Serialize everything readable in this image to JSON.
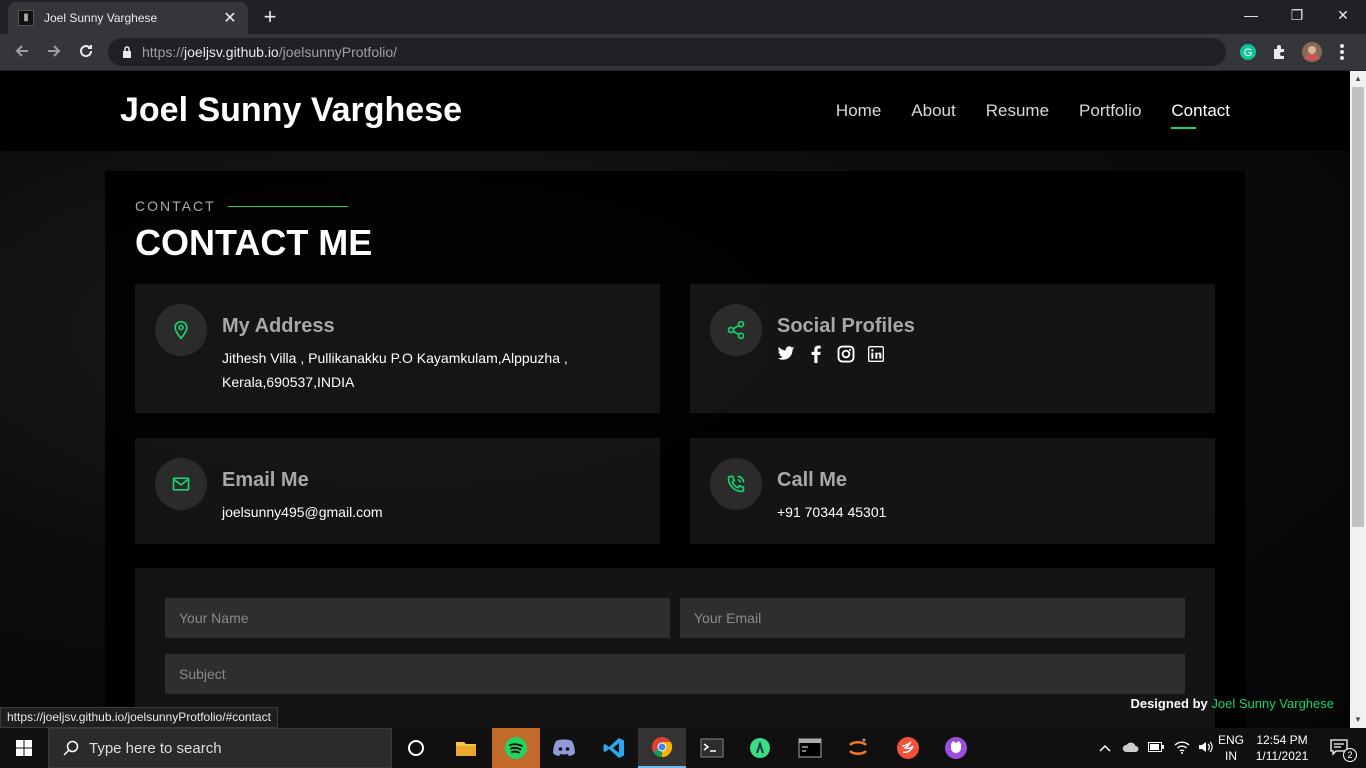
{
  "browser": {
    "tab_title": "Joel Sunny Varghese",
    "tab_close": "✕",
    "new_tab": "+",
    "url_scheme": "https://",
    "url_host": "joeljsv.github.io",
    "url_path": "/joelsunnyProtfolio/",
    "status_url": "https://joeljsv.github.io/joelsunnyProtfolio/#contact",
    "win_min": "—",
    "win_restore": "❐",
    "win_close": "✕"
  },
  "site": {
    "brand": "Joel Sunny Varghese",
    "nav": [
      "Home",
      "About",
      "Resume",
      "Portfolio",
      "Contact"
    ],
    "active_nav": "Contact",
    "accent": "#18d26e"
  },
  "contact": {
    "label": "CONTACT",
    "title": "CONTACT ME",
    "address_title": "My Address",
    "address_line1": "Jithesh Villa , Pullikanakku P.O Kayamkulam,Alppuzha ,",
    "address_line2": "Kerala,690537,INDIA",
    "social_title": "Social Profiles",
    "social_icons": [
      "twitter-icon",
      "facebook-icon",
      "instagram-icon",
      "linkedin-icon"
    ],
    "email_title": "Email Me",
    "email": "joelsunny495@gmail.com",
    "call_title": "Call Me",
    "phone": "+91 70344 45301"
  },
  "form": {
    "name_placeholder": "Your Name",
    "email_placeholder": "Your Email",
    "subject_placeholder": "Subject"
  },
  "footer": {
    "designed_by": "Designed by",
    "designer": "Joel Sunny Varghese"
  },
  "taskbar": {
    "search_placeholder": "Type here to search",
    "lang_top": "ENG",
    "lang_bottom": "IN",
    "time": "12:54 PM",
    "date": "1/11/2021",
    "notification_count": "2",
    "apps": [
      "cortana-icon",
      "file-explorer-icon",
      "spotify-icon",
      "discord-icon",
      "vscode-icon",
      "chrome-icon",
      "terminal-icon",
      "android-studio-icon",
      "cmd-icon",
      "jupyter-icon",
      "swift-icon",
      "github-desktop-icon"
    ]
  }
}
